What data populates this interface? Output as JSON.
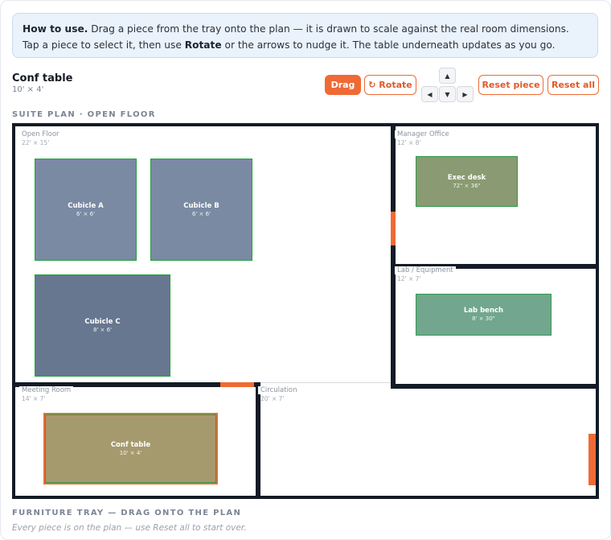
{
  "help": {
    "lead": "How to use.",
    "part1": " Drag a piece from the tray onto the plan — it is drawn to scale against the real room dimensions. Tap a piece to select it, then use ",
    "rotate_word": "Rotate",
    "part2": " or the arrows to nudge it. The table underneath updates as you go."
  },
  "selected": {
    "name": "Conf table",
    "dims": "10' × 4'"
  },
  "toolbar": {
    "drag": "Drag",
    "rotate": "↻ Rotate",
    "reset_piece": "Reset piece",
    "reset_all": "Reset all",
    "arrow_up": "▲",
    "arrow_left": "◀",
    "arrow_down": "▼",
    "arrow_right": "▶"
  },
  "plan_title": "SUITE PLAN · OPEN FLOOR",
  "rooms": {
    "open_floor": {
      "name": "Open Floor",
      "dims": "22' × 15'"
    },
    "manager_office": {
      "name": "Manager Office",
      "dims": "12' × 8'"
    },
    "lab": {
      "name": "Lab / Equipment",
      "dims": "12' × 7'"
    },
    "meeting": {
      "name": "Meeting Room",
      "dims": "14' × 7'"
    },
    "circulation": {
      "name": "Circulation",
      "dims": "20' × 7'"
    }
  },
  "pieces": {
    "cubicle_a": {
      "name": "Cubicle A",
      "dims": "6' × 6'"
    },
    "cubicle_b": {
      "name": "Cubicle B",
      "dims": "6' × 6'"
    },
    "cubicle_c": {
      "name": "Cubicle C",
      "dims": "8' × 6'"
    },
    "exec_desk": {
      "name": "Exec desk",
      "dims": "72\" × 36\""
    },
    "lab_bench": {
      "name": "Lab bench",
      "dims": "8' × 30\""
    },
    "conf_table": {
      "name": "Conf table",
      "dims": "10' × 4'"
    }
  },
  "tray": {
    "title": "FURNITURE TRAY — DRAG ONTO THE PLAN",
    "note": "Every piece is on the plan — use Reset all to start over."
  },
  "colors": {
    "accent": "#ef6a35",
    "wall": "#141b26",
    "piece_border": "#2e9a4c",
    "cubicle": "#7a8aa3",
    "cubicle_c": "#67778f",
    "exec_desk": "#8a9a72",
    "lab_bench": "#72a68e",
    "conf_table": "#a59a6e"
  }
}
